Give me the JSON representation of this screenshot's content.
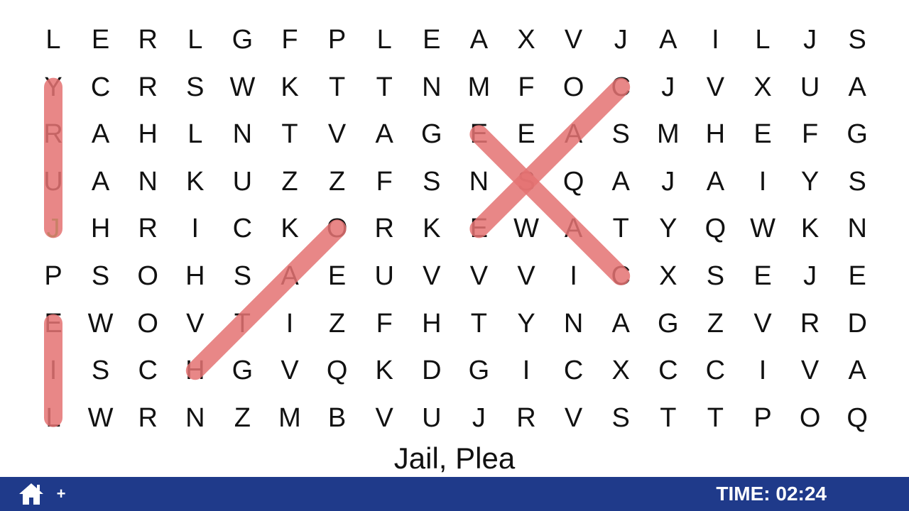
{
  "grid": {
    "rows": [
      [
        "L",
        "E",
        "R",
        "L",
        "G",
        "F",
        "P",
        "L",
        "E",
        "A",
        "X",
        "V",
        "J",
        "A",
        "I",
        "L",
        "J",
        "S"
      ],
      [
        "Y",
        "C",
        "R",
        "S",
        "W",
        "K",
        "T",
        "T",
        "N",
        "M",
        "F",
        "O",
        "C",
        "J",
        "V",
        "X",
        "U",
        "A"
      ],
      [
        "R",
        "A",
        "H",
        "L",
        "N",
        "T",
        "V",
        "A",
        "G",
        "E",
        "E",
        "A",
        "S",
        "M",
        "H",
        "E",
        "F",
        "G"
      ],
      [
        "U",
        "A",
        "N",
        "K",
        "U",
        "Z",
        "Z",
        "F",
        "S",
        "N",
        "S",
        "Q",
        "A",
        "J",
        "A",
        "I",
        "Y",
        "S"
      ],
      [
        "J",
        "H",
        "R",
        "I",
        "C",
        "K",
        "O",
        "R",
        "K",
        "E",
        "W",
        "A",
        "T",
        "Y",
        "Q",
        "W",
        "K",
        "N"
      ],
      [
        "P",
        "S",
        "O",
        "H",
        "S",
        "A",
        "E",
        "U",
        "V",
        "V",
        "V",
        "I",
        "C",
        "X",
        "S",
        "E",
        "J",
        "E"
      ],
      [
        "E",
        "W",
        "O",
        "V",
        "T",
        "I",
        "Z",
        "F",
        "H",
        "T",
        "Y",
        "N",
        "A",
        "G",
        "Z",
        "V",
        "R",
        "D"
      ],
      [
        "I",
        "S",
        "C",
        "H",
        "G",
        "V",
        "Q",
        "K",
        "D",
        "G",
        "I",
        "C",
        "X",
        "C",
        "C",
        "I",
        "V",
        "A"
      ],
      [
        "L",
        "W",
        "R",
        "N",
        "Z",
        "M",
        "B",
        "V",
        "U",
        "J",
        "R",
        "V",
        "S",
        "T",
        "T",
        "P",
        "O",
        "Q"
      ]
    ],
    "highlight_color": "#e57373",
    "active_letter": {
      "row": 4,
      "col": 0,
      "color": "#22cc22"
    }
  },
  "found_words": [
    {
      "start": [
        4,
        0
      ],
      "end": [
        1,
        0
      ]
    },
    {
      "start": [
        7,
        3
      ],
      "end": [
        4,
        6
      ]
    },
    {
      "start": [
        2,
        9
      ],
      "end": [
        5,
        12
      ]
    },
    {
      "start": [
        4,
        9
      ],
      "end": [
        1,
        12
      ]
    },
    {
      "start": [
        6,
        0
      ],
      "end": [
        8,
        0
      ]
    }
  ],
  "clue": {
    "text": "Jail, Plea"
  },
  "bottom_bar": {
    "home_icon": "home-icon",
    "plus_label": "+",
    "timer_text": "TIME: 02:24",
    "background_color": "#1f3a8a"
  }
}
